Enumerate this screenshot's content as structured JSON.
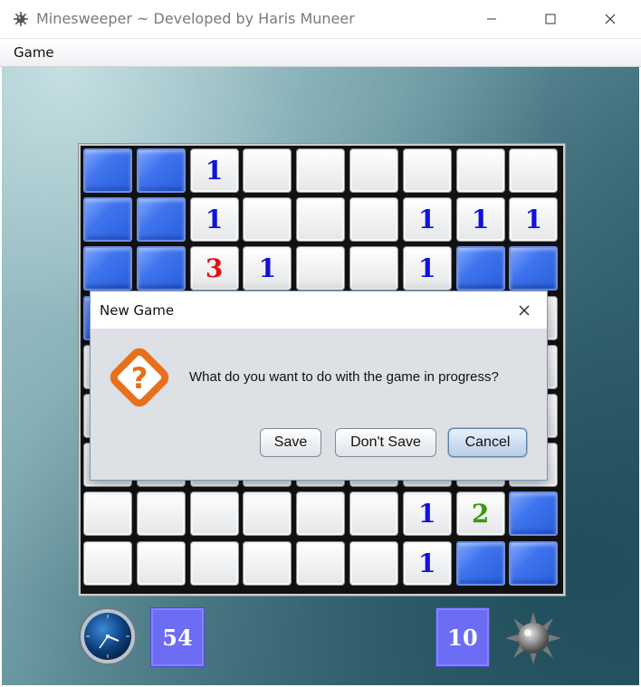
{
  "window": {
    "title": "Minesweeper ~ Developed by Haris Muneer",
    "minimize_glyph": "—",
    "maximize_glyph": "☐",
    "close_glyph": "✕"
  },
  "menu": {
    "game_label": "Game"
  },
  "board": {
    "rows": 9,
    "cols": 9,
    "number_colors": {
      "1": "#1010e0",
      "2": "#3a9a10",
      "3": "#e01010"
    },
    "cells": [
      [
        "C",
        "C",
        "1",
        "",
        "",
        "",
        "",
        "",
        ""
      ],
      [
        "C",
        "C",
        "1",
        "",
        "",
        "",
        "1",
        "1",
        "1"
      ],
      [
        "C",
        "C",
        "3",
        "1",
        "",
        "",
        "1",
        "C",
        "C"
      ],
      [
        "C",
        "",
        "",
        "",
        "",
        "",
        "",
        "",
        ""
      ],
      [
        "",
        "",
        "",
        "",
        "",
        "",
        "",
        "",
        ""
      ],
      [
        "",
        "",
        "",
        "",
        "",
        "",
        "",
        "",
        ""
      ],
      [
        "",
        "",
        "",
        "",
        "",
        "",
        "",
        "",
        ""
      ],
      [
        "",
        "",
        "",
        "",
        "",
        "",
        "1",
        "2",
        "C"
      ],
      [
        "",
        "",
        "",
        "",
        "",
        "",
        "1",
        "C",
        "C"
      ]
    ]
  },
  "status": {
    "time": "54",
    "mines_left": "10",
    "clock_icon": "clock-icon",
    "mine_icon": "mine-icon"
  },
  "dialog": {
    "title": "New Game",
    "close_glyph": "✕",
    "icon": "question-icon",
    "message": "What do you want to do with the game in progress?",
    "save_label": "Save",
    "dont_save_label": "Don't Save",
    "cancel_label": "Cancel"
  }
}
